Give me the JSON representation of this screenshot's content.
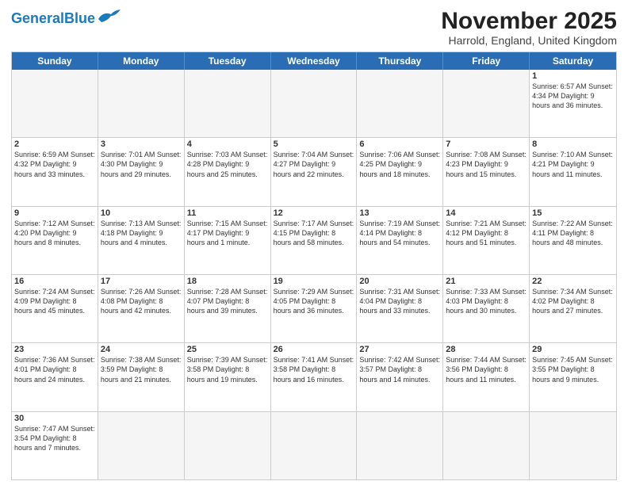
{
  "header": {
    "logo_general": "General",
    "logo_blue": "Blue",
    "month_title": "November 2025",
    "location": "Harrold, England, United Kingdom"
  },
  "days_of_week": [
    "Sunday",
    "Monday",
    "Tuesday",
    "Wednesday",
    "Thursday",
    "Friday",
    "Saturday"
  ],
  "rows": [
    {
      "cells": [
        {
          "day": "",
          "empty": true,
          "info": ""
        },
        {
          "day": "",
          "empty": true,
          "info": ""
        },
        {
          "day": "",
          "empty": true,
          "info": ""
        },
        {
          "day": "",
          "empty": true,
          "info": ""
        },
        {
          "day": "",
          "empty": true,
          "info": ""
        },
        {
          "day": "",
          "empty": true,
          "info": ""
        },
        {
          "day": "1",
          "empty": false,
          "info": "Sunrise: 6:57 AM\nSunset: 4:34 PM\nDaylight: 9 hours\nand 36 minutes."
        }
      ]
    },
    {
      "cells": [
        {
          "day": "2",
          "empty": false,
          "info": "Sunrise: 6:59 AM\nSunset: 4:32 PM\nDaylight: 9 hours\nand 33 minutes."
        },
        {
          "day": "3",
          "empty": false,
          "info": "Sunrise: 7:01 AM\nSunset: 4:30 PM\nDaylight: 9 hours\nand 29 minutes."
        },
        {
          "day": "4",
          "empty": false,
          "info": "Sunrise: 7:03 AM\nSunset: 4:28 PM\nDaylight: 9 hours\nand 25 minutes."
        },
        {
          "day": "5",
          "empty": false,
          "info": "Sunrise: 7:04 AM\nSunset: 4:27 PM\nDaylight: 9 hours\nand 22 minutes."
        },
        {
          "day": "6",
          "empty": false,
          "info": "Sunrise: 7:06 AM\nSunset: 4:25 PM\nDaylight: 9 hours\nand 18 minutes."
        },
        {
          "day": "7",
          "empty": false,
          "info": "Sunrise: 7:08 AM\nSunset: 4:23 PM\nDaylight: 9 hours\nand 15 minutes."
        },
        {
          "day": "8",
          "empty": false,
          "info": "Sunrise: 7:10 AM\nSunset: 4:21 PM\nDaylight: 9 hours\nand 11 minutes."
        }
      ]
    },
    {
      "cells": [
        {
          "day": "9",
          "empty": false,
          "info": "Sunrise: 7:12 AM\nSunset: 4:20 PM\nDaylight: 9 hours\nand 8 minutes."
        },
        {
          "day": "10",
          "empty": false,
          "info": "Sunrise: 7:13 AM\nSunset: 4:18 PM\nDaylight: 9 hours\nand 4 minutes."
        },
        {
          "day": "11",
          "empty": false,
          "info": "Sunrise: 7:15 AM\nSunset: 4:17 PM\nDaylight: 9 hours\nand 1 minute."
        },
        {
          "day": "12",
          "empty": false,
          "info": "Sunrise: 7:17 AM\nSunset: 4:15 PM\nDaylight: 8 hours\nand 58 minutes."
        },
        {
          "day": "13",
          "empty": false,
          "info": "Sunrise: 7:19 AM\nSunset: 4:14 PM\nDaylight: 8 hours\nand 54 minutes."
        },
        {
          "day": "14",
          "empty": false,
          "info": "Sunrise: 7:21 AM\nSunset: 4:12 PM\nDaylight: 8 hours\nand 51 minutes."
        },
        {
          "day": "15",
          "empty": false,
          "info": "Sunrise: 7:22 AM\nSunset: 4:11 PM\nDaylight: 8 hours\nand 48 minutes."
        }
      ]
    },
    {
      "cells": [
        {
          "day": "16",
          "empty": false,
          "info": "Sunrise: 7:24 AM\nSunset: 4:09 PM\nDaylight: 8 hours\nand 45 minutes."
        },
        {
          "day": "17",
          "empty": false,
          "info": "Sunrise: 7:26 AM\nSunset: 4:08 PM\nDaylight: 8 hours\nand 42 minutes."
        },
        {
          "day": "18",
          "empty": false,
          "info": "Sunrise: 7:28 AM\nSunset: 4:07 PM\nDaylight: 8 hours\nand 39 minutes."
        },
        {
          "day": "19",
          "empty": false,
          "info": "Sunrise: 7:29 AM\nSunset: 4:05 PM\nDaylight: 8 hours\nand 36 minutes."
        },
        {
          "day": "20",
          "empty": false,
          "info": "Sunrise: 7:31 AM\nSunset: 4:04 PM\nDaylight: 8 hours\nand 33 minutes."
        },
        {
          "day": "21",
          "empty": false,
          "info": "Sunrise: 7:33 AM\nSunset: 4:03 PM\nDaylight: 8 hours\nand 30 minutes."
        },
        {
          "day": "22",
          "empty": false,
          "info": "Sunrise: 7:34 AM\nSunset: 4:02 PM\nDaylight: 8 hours\nand 27 minutes."
        }
      ]
    },
    {
      "cells": [
        {
          "day": "23",
          "empty": false,
          "info": "Sunrise: 7:36 AM\nSunset: 4:01 PM\nDaylight: 8 hours\nand 24 minutes."
        },
        {
          "day": "24",
          "empty": false,
          "info": "Sunrise: 7:38 AM\nSunset: 3:59 PM\nDaylight: 8 hours\nand 21 minutes."
        },
        {
          "day": "25",
          "empty": false,
          "info": "Sunrise: 7:39 AM\nSunset: 3:58 PM\nDaylight: 8 hours\nand 19 minutes."
        },
        {
          "day": "26",
          "empty": false,
          "info": "Sunrise: 7:41 AM\nSunset: 3:58 PM\nDaylight: 8 hours\nand 16 minutes."
        },
        {
          "day": "27",
          "empty": false,
          "info": "Sunrise: 7:42 AM\nSunset: 3:57 PM\nDaylight: 8 hours\nand 14 minutes."
        },
        {
          "day": "28",
          "empty": false,
          "info": "Sunrise: 7:44 AM\nSunset: 3:56 PM\nDaylight: 8 hours\nand 11 minutes."
        },
        {
          "day": "29",
          "empty": false,
          "info": "Sunrise: 7:45 AM\nSunset: 3:55 PM\nDaylight: 8 hours\nand 9 minutes."
        }
      ]
    },
    {
      "cells": [
        {
          "day": "30",
          "empty": false,
          "info": "Sunrise: 7:47 AM\nSunset: 3:54 PM\nDaylight: 8 hours\nand 7 minutes."
        },
        {
          "day": "",
          "empty": true,
          "info": ""
        },
        {
          "day": "",
          "empty": true,
          "info": ""
        },
        {
          "day": "",
          "empty": true,
          "info": ""
        },
        {
          "day": "",
          "empty": true,
          "info": ""
        },
        {
          "day": "",
          "empty": true,
          "info": ""
        },
        {
          "day": "",
          "empty": true,
          "info": ""
        }
      ]
    }
  ]
}
